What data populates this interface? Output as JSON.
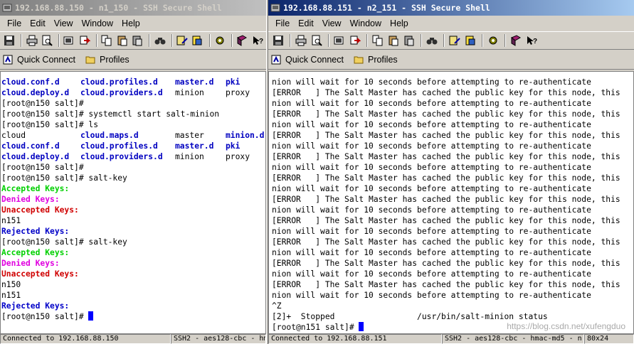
{
  "left": {
    "title": "192.168.88.150 - n1_150 - SSH Secure Shell",
    "menu": [
      "File",
      "Edit",
      "View",
      "Window",
      "Help"
    ],
    "quick_connect": "Quick Connect",
    "profiles": "Profiles",
    "status": [
      "Connected to 192.168.88.150",
      "SSH2 - aes128-cbc - hm"
    ]
  },
  "right": {
    "title": "192.168.88.151 - n2_151 - SSH Secure Shell",
    "menu": [
      "File",
      "Edit",
      "View",
      "Window",
      "Help"
    ],
    "quick_connect": "Quick Connect",
    "profiles": "Profiles",
    "status": [
      "Connected to 192.168.88.151",
      "SSH2 - aes128-cbc - hmac-md5 - n",
      "80x24"
    ]
  },
  "left_terminal": {
    "ls1": [
      [
        "cloud.conf.d",
        "cloud.profiles.d",
        "master.d",
        "pki"
      ],
      [
        "cloud.deploy.d",
        "cloud.providers.d",
        "minion",
        "proxy"
      ]
    ],
    "l_prompt1": "[root@n150 salt]#",
    "l_cmd_start": "[root@n150 salt]# systemctl start salt-minion",
    "l_cmd_ls": "[root@n150 salt]# ls",
    "ls2": [
      [
        "cloud",
        "cloud.maps.d",
        "master",
        "minion.d"
      ],
      [
        "cloud.conf.d",
        "cloud.profiles.d",
        "master.d",
        "pki"
      ],
      [
        "cloud.deploy.d",
        "cloud.providers.d",
        "minion",
        "proxy"
      ]
    ],
    "l_prompt2": "[root@n150 salt]#",
    "l_cmd_saltkey1": "[root@n150 salt]# salt-key",
    "accepted": "Accepted Keys:",
    "denied": "Denied Keys:",
    "unaccepted": "Unaccepted Keys:",
    "key_n151": "n151",
    "rejected": "Rejected Keys:",
    "l_cmd_saltkey2": "[root@n150 salt]# salt-key",
    "key_n150": "n150",
    "l_prompt_final": "[root@n150 salt]# "
  },
  "right_terminal": {
    "first_line": "nion will wait for 10 seconds before attempting to re-authenticate",
    "error_line": "[ERROR   ] The Salt Master has cached the public key for this node, this",
    "wait_line": "nion will wait for 10 seconds before attempting to re-authenticate",
    "repeat_count": 10,
    "ctrl_z": "^Z",
    "stopped": "[2]+  Stopped                 /usr/bin/salt-minion status",
    "prompt_final": "[root@n151 salt]# "
  },
  "watermark": "https://blog.csdn.net/xufengduo",
  "colors": {
    "cyan_dir": "#0000c0",
    "accepted": "#00d000",
    "denied": "#e000e0",
    "unaccepted": "#d00000",
    "rejected": "#0000c8",
    "cursor": "#0000ff"
  }
}
